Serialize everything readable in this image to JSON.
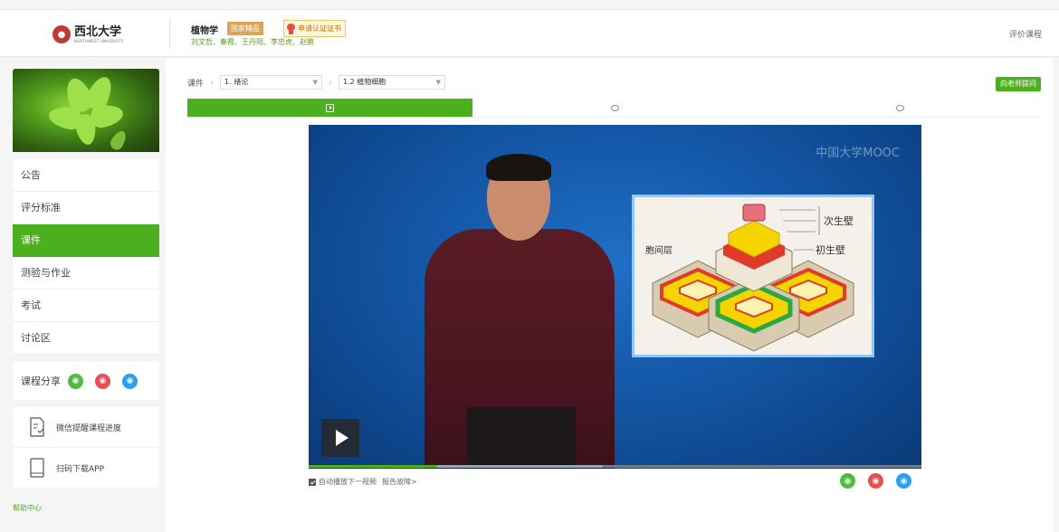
{
  "header": {
    "university_name": "西北大学",
    "university_sub": "NORTHWEST UNIVERSITY",
    "course_title": "植物学",
    "national_badge": "国家精品",
    "cert_label": "申请认证证书",
    "teachers": "刘文哲、秦霞、王丹阳、李忠虎、赵鹏",
    "rate_label": "评价课程"
  },
  "sidebar": {
    "menu": [
      {
        "label": "公告",
        "active": false
      },
      {
        "label": "评分标准",
        "active": false
      },
      {
        "label": "课件",
        "active": true
      },
      {
        "label": "测验与作业",
        "active": false
      },
      {
        "label": "考试",
        "active": false
      },
      {
        "label": "讨论区",
        "active": false
      }
    ],
    "share_label": "课程分享",
    "tools": [
      {
        "label": "微信提醒课程进度",
        "icon": "wechat-reminder-icon"
      },
      {
        "label": "扫码下载APP",
        "icon": "phone-icon"
      }
    ],
    "help_label": "帮助中心"
  },
  "courseware": {
    "crumb_root": "课件",
    "chapter": "1. 绪论",
    "lesson": "1.2 植物细胞",
    "ask_button": "向老师提问"
  },
  "video": {
    "watermark": "中国大学MOOC",
    "diagram_labels": {
      "secondary_wall": "次生壁",
      "primary_wall": "初生壁",
      "middle_lamella": "胞间层"
    },
    "progress_fraction": 0.21,
    "buffer_fraction": 0.48
  },
  "below_video": {
    "autoplay_label": "自动播放下一视频",
    "report_label": "报告故障>",
    "autoplay_checked": true
  },
  "colors": {
    "accent": "#4caf1e",
    "wechat": "#4cbe37",
    "weibo": "#ee4d4d",
    "qq": "#2a9df4"
  }
}
